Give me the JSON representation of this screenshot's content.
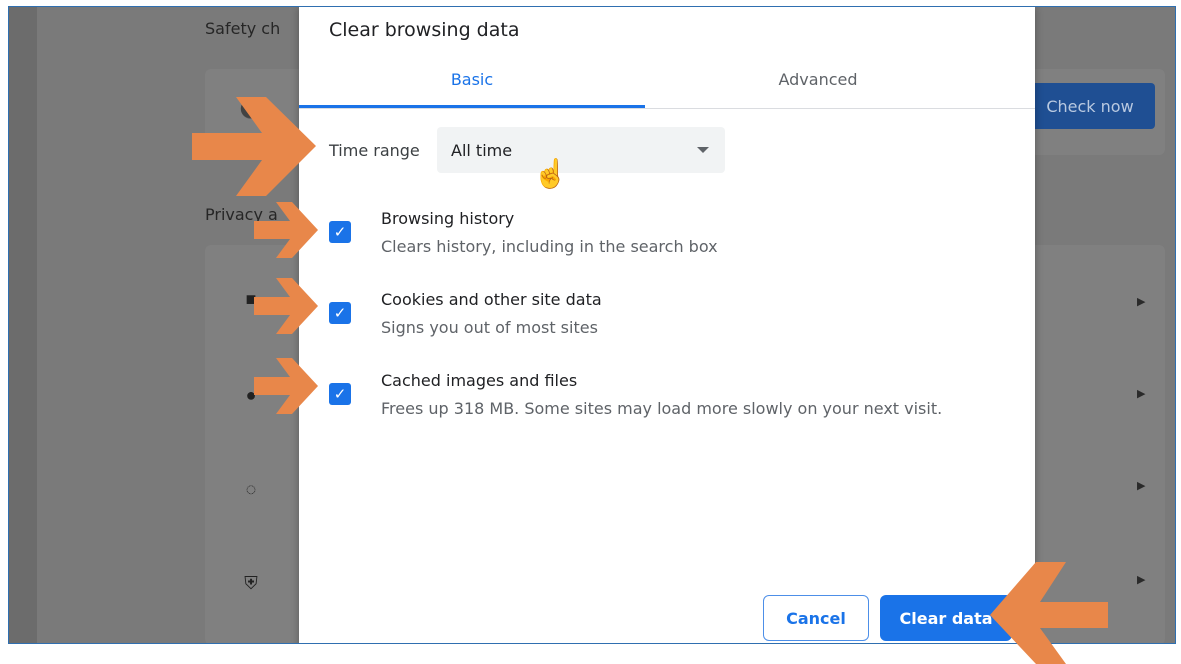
{
  "background": {
    "safety_check_label": "Safety ch",
    "privacy_label": "Privacy a",
    "check_now_label": "Check now"
  },
  "dialog": {
    "title": "Clear browsing data",
    "tabs": [
      {
        "label": "Basic",
        "active": true
      },
      {
        "label": "Advanced",
        "active": false
      }
    ],
    "time_range": {
      "label": "Time range",
      "value": "All time"
    },
    "options": [
      {
        "title": "Browsing history",
        "description": "Clears history, including in the search box",
        "checked": true
      },
      {
        "title": "Cookies and other site data",
        "description": "Signs you out of most sites",
        "checked": true
      },
      {
        "title": "Cached images and files",
        "description": "Frees up 318 MB. Some sites may load more slowly on your next visit.",
        "checked": true
      }
    ],
    "buttons": {
      "cancel": "Cancel",
      "clear": "Clear data"
    }
  },
  "colors": {
    "accent": "#1a73e8",
    "annotation_arrow": "#e8874a",
    "overlay": "#7a7a7a"
  }
}
